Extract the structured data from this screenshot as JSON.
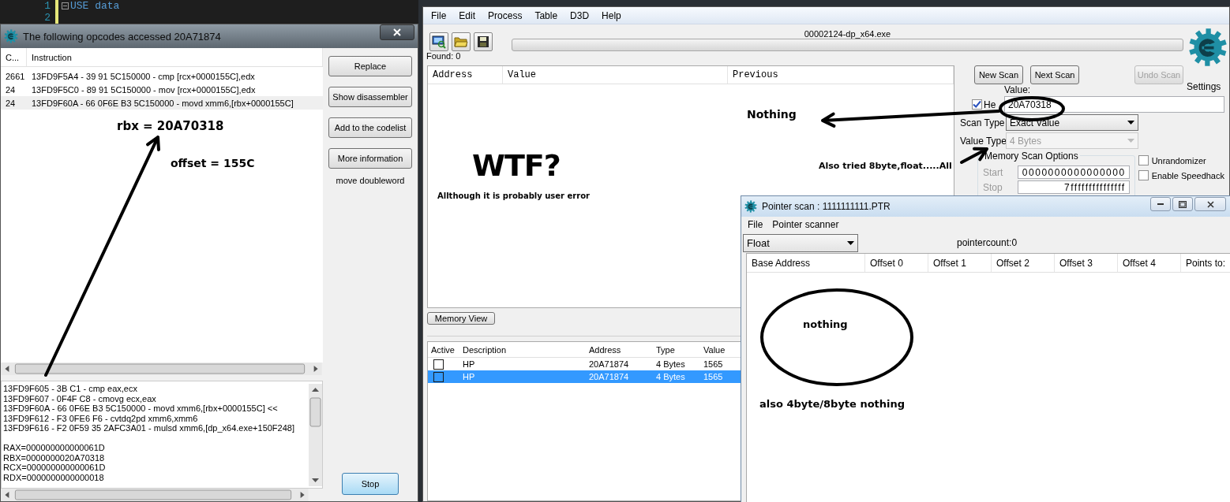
{
  "editor": {
    "lines": [
      {
        "number": "1",
        "code": "USE data"
      },
      {
        "number": "2"
      }
    ]
  },
  "opcodes_window": {
    "title": "The following opcodes accessed 20A71874",
    "columns": [
      "C...",
      "Instruction"
    ],
    "rows": [
      {
        "count": "2661",
        "instruction": "13FD9F5A4 - 39 91 5C150000  - cmp [rcx+0000155C],edx",
        "selected": false
      },
      {
        "count": "24",
        "instruction": "13FD9F5C0 - 89 91 5C150000  - mov [rcx+0000155C],edx",
        "selected": false
      },
      {
        "count": "24",
        "instruction": "13FD9F60A - 66 0F6E B3 5C150000  - movd xmm6,[rbx+0000155C]",
        "selected": true
      }
    ],
    "buttons": [
      "Replace",
      "Show disassembler",
      "Add to the codelist",
      "More information"
    ],
    "description": "move doubleword",
    "disassembly": [
      "13FD9F605 - 3B C1  - cmp eax,ecx",
      "13FD9F607 - 0F4F C8  - cmovg ecx,eax",
      "13FD9F60A - 66 0F6E B3 5C150000  - movd xmm6,[rbx+0000155C] <<",
      "13FD9F612 - F3 0FE6 F6  - cvtdq2pd xmm6,xmm6",
      "13FD9F616 - F2 0F59 35 2AFC3A01  - mulsd xmm6,[dp_x64.exe+150F248]"
    ],
    "registers": [
      "RAX=000000000000061D",
      "RBX=0000000020A70318",
      "RCX=000000000000061D",
      "RDX=0000000000000018"
    ],
    "stop_button": "Stop"
  },
  "main_window": {
    "menu": [
      "File",
      "Edit",
      "Process",
      "Table",
      "D3D",
      "Help"
    ],
    "process": "00002124-dp_x64.exe",
    "progress": {
      "level": 0
    },
    "found": "Found: 0",
    "settings": "Settings",
    "results_columns": [
      "Address",
      "Value",
      "Previous"
    ],
    "scan_buttons": [
      {
        "label": "New Scan",
        "disabled": false
      },
      {
        "label": "Next Scan",
        "disabled": false
      },
      {
        "label": "Undo Scan",
        "disabled": true
      }
    ],
    "value_label": "Value:",
    "hex": {
      "label": "He",
      "checked": true
    },
    "value": "20A70318",
    "scan_type": {
      "label": "Scan Type",
      "value": "Exact Value",
      "disabled": false
    },
    "value_type": {
      "label": "Value Type",
      "value": "4 Bytes",
      "disabled": true
    },
    "memory_options": {
      "title": "Memory Scan Options",
      "start_label": "Start",
      "start": "0000000000000000",
      "stop_label": "Stop",
      "stop": "7fffffffffffffff"
    },
    "options": [
      {
        "label": "Unrandomizer",
        "checked": false
      },
      {
        "label": "Enable Speedhack",
        "checked": false
      }
    ],
    "memory_view_button": "Memory View",
    "address_columns": [
      "Active",
      "Description",
      "Address",
      "Type",
      "Value"
    ],
    "address_rows": [
      {
        "active": false,
        "description": "HP",
        "address": "20A71874",
        "type": "4 Bytes",
        "value": "1565",
        "selected": false
      },
      {
        "active": false,
        "description": "HP",
        "address": "20A71874",
        "type": "4 Bytes",
        "value": "1565",
        "selected": true
      }
    ]
  },
  "pointer_window": {
    "title": "Pointer scan : 1111111111.PTR",
    "menu": [
      "File",
      "Pointer scanner"
    ],
    "type": "Float",
    "pointercount": "pointercount:0",
    "columns": [
      "Base Address",
      "Offset 0",
      "Offset 1",
      "Offset 2",
      "Offset 3",
      "Offset 4",
      "Points to:"
    ]
  },
  "annotations": [
    "rbx = 20A70318",
    "offset = 155C",
    "Nothing",
    "WTF?",
    "Allthough it is probably user error",
    "Also tried 8byte,float.....All",
    "nothing",
    "also 4byte/8byte nothing"
  ]
}
